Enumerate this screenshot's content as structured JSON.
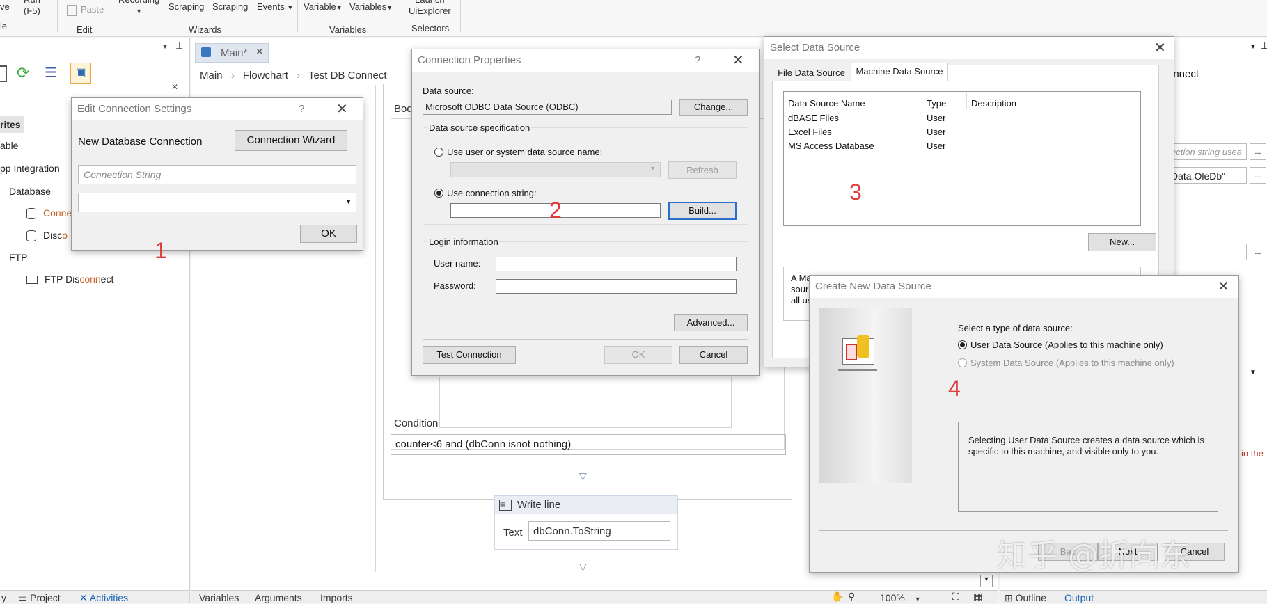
{
  "ribbon": {
    "run_label": "Run",
    "run_key": "(F5)",
    "paste_label": "Paste",
    "edit_group": "Edit",
    "recording_label": "Recording",
    "screen_scraping_label": "Scraping",
    "data_scraping_label": "Scraping",
    "user_events_label": "Events",
    "wizards_group": "Wizards",
    "create_variable_label": "Variable",
    "manage_variables_label": "Variables",
    "variables_group": "Variables",
    "launch_label": "Launch",
    "uiexplorer_label": "UiExplorer",
    "selectors_group": "Selectors",
    "left_group_fragment": "le",
    "left_item_fragment": "ve"
  },
  "activities": {
    "favorites": "rites",
    "available": "able",
    "app_integration": "pp Integration",
    "database": "Database",
    "connect_a": "Conne",
    "disconnect_a": "Disc",
    "disconnect_b": "o",
    "ftp": "FTP",
    "ftp_disconnect_a": "FTP Dis",
    "ftp_disconnect_b": "conn",
    "ftp_disconnect_c": "ect"
  },
  "bottom_left_tabs": {
    "y": "y",
    "project": "Project",
    "activities": "Activities"
  },
  "doc_tab": {
    "label": "Main*"
  },
  "breadcrumb": {
    "main": "Main",
    "flowchart": "Flowchart",
    "current": "Test DB Connect"
  },
  "workflow": {
    "body_label": "Bod",
    "condition_label": "Condition",
    "condition_value": "counter<6 and (dbConn isnot nothing)",
    "writeline_title": "Write line",
    "text_label": "Text",
    "text_value": "dbConn.ToString"
  },
  "bottom_tabs": {
    "variables": "Variables",
    "arguments": "Arguments",
    "imports": "Imports",
    "zoom": "100%"
  },
  "right_panel": {
    "header_fragment": "onnect",
    "connection_string_placeholder": "ection string usea",
    "provider_value": "Data.OleDb\"",
    "ellipsis": "...",
    "error_fragment": "in the",
    "outline_tab": "Outline",
    "output_tab": "Output"
  },
  "edit_connection": {
    "title": "Edit Connection Settings",
    "help": "?",
    "close": "✕",
    "new_db_label": "New Database Connection",
    "wizard_button": "Connection Wizard",
    "conn_string_placeholder": "Connection String",
    "ok_button": "OK"
  },
  "conn_props": {
    "title": "Connection Properties",
    "help": "?",
    "close": "✕",
    "data_source_label": "Data source:",
    "data_source_value": "Microsoft ODBC Data Source (ODBC)",
    "change_button": "Change...",
    "spec_group": "Data source specification",
    "use_dsn_label": "Use user or system data source name:",
    "refresh_button": "Refresh",
    "use_connstring_label": "Use connection string:",
    "build_button": "Build...",
    "login_group": "Login information",
    "username_label": "User name:",
    "password_label": "Password:",
    "advanced_button": "Advanced...",
    "test_button": "Test Connection",
    "ok_button": "OK",
    "cancel_button": "Cancel"
  },
  "select_ds": {
    "title": "Select Data Source",
    "close": "✕",
    "tab_file": "File Data Source",
    "tab_machine": "Machine Data Source",
    "col_name": "Data Source Name",
    "col_type": "Type",
    "col_desc": "Description",
    "rows": [
      {
        "name": "dBASE Files",
        "type": "User"
      },
      {
        "name": "Excel Files",
        "type": "User"
      },
      {
        "name": "MS Access Database",
        "type": "User"
      }
    ],
    "new_button": "New...",
    "desc_line1": "A Ma",
    "desc_line2": "sour",
    "desc_line3": "all us"
  },
  "create_ds": {
    "title": "Create New Data Source",
    "close": "✕",
    "prompt": "Select a type of data source:",
    "user_option": "User Data Source (Applies to this machine only)",
    "system_option": "System Data Source (Applies to this machine only)",
    "description": "Selecting User Data Source creates a data source which is specific to this machine, and visible only to you.",
    "back_button": "Bac",
    "next_button": "Next",
    "cancel_button": "Cancel"
  },
  "annotations": {
    "one": "1",
    "two": "2",
    "three": "3",
    "four": "4"
  },
  "watermark": {
    "text": "知乎 @折向东"
  }
}
